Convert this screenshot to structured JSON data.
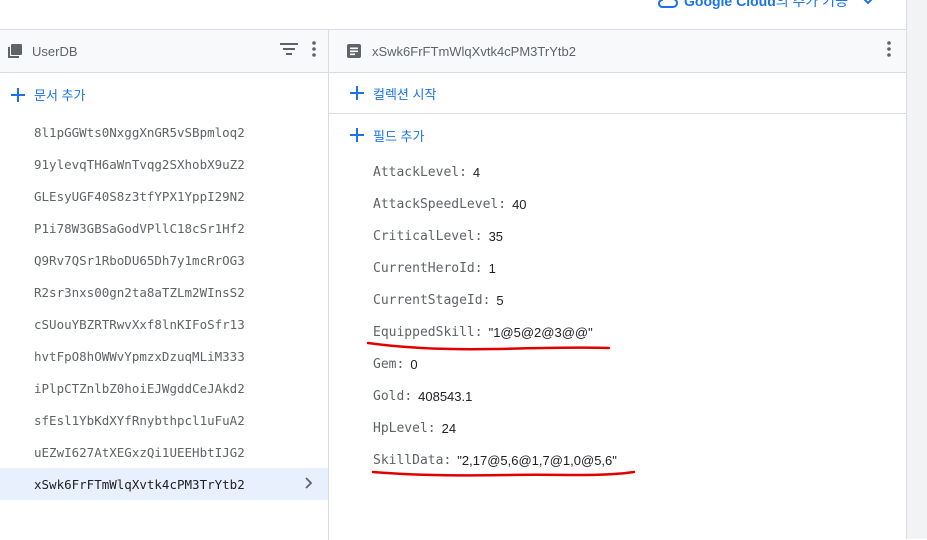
{
  "top": {
    "google_cloud_brand": "Google Cloud",
    "google_cloud_suffix": "의 추가 기능"
  },
  "left_panel": {
    "title": "UserDB",
    "add_document_label": "문서 추가",
    "documents": [
      "8l1pGGWts0NxggXnGR5vSBpmloq2",
      "91ylevqTH6aWnTvqg2SXhobX9uZ2",
      "GLEsyUGF40S8z3tfYPX1YppI29N2",
      "P1i78W3GBSaGodVPllC18cSr1Hf2",
      "Q9Rv7QSr1RboDU65Dh7y1mcRrOG3",
      "R2sr3nxs00gn2ta8aTZLm2WInsS2",
      "cSUouYBZRTRwvXxf8lnKIFoSfr13",
      "hvtFpO8hOWWvYpmzxDzuqMLiM333",
      "iPlpCTZnlbZ0hoiEJWgddCeJAkd2",
      "sfEsl1YbKdXYfRnybthpcl1uFuA2",
      "uEZwI627AtXEGxzQi1UEEHbtIJG2",
      "xSwk6FrFTmWlqXvtk4cPM3TrYtb2"
    ],
    "selected_index": 11
  },
  "right_panel": {
    "title": "xSwk6FrFTmWlqXvtk4cPM3TrYtb2",
    "start_collection_label": "컬렉션 시작",
    "add_field_label": "필드 추가",
    "fields": [
      {
        "name": "AttackLevel",
        "value": "4"
      },
      {
        "name": "AttackSpeedLevel",
        "value": "40"
      },
      {
        "name": "CriticalLevel",
        "value": "35"
      },
      {
        "name": "CurrentHeroId",
        "value": "1"
      },
      {
        "name": "CurrentStageId",
        "value": "5"
      },
      {
        "name": "EquippedSkill",
        "value": "\"1@5@2@3@@\""
      },
      {
        "name": "Gem",
        "value": "0"
      },
      {
        "name": "Gold",
        "value": "408543.1"
      },
      {
        "name": "HpLevel",
        "value": "24"
      },
      {
        "name": "SkillData",
        "value": "\"2,17@5,6@1,7@1,0@5,6\""
      }
    ]
  },
  "colors": {
    "accent": "#1a73e8",
    "annotation": "#e00000"
  }
}
